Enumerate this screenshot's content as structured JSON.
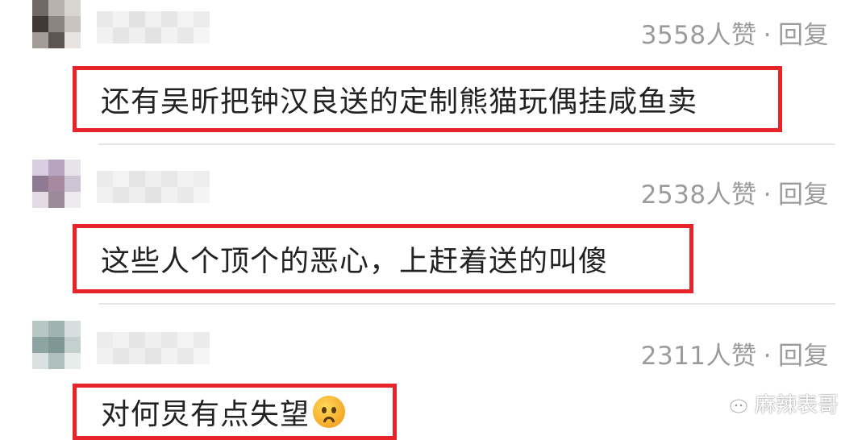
{
  "comments": [
    {
      "likes": "3558人赞",
      "separator": "·",
      "reply": "回复",
      "text": "还有吴昕把钟汉良送的定制熊猫玩偶挂咸鱼卖",
      "has_emoji": false
    },
    {
      "likes": "2538人赞",
      "separator": "·",
      "reply": "回复",
      "text": "这些人个顶个的恶心，上赶着送的叫傻",
      "has_emoji": false
    },
    {
      "likes": "2311人赞",
      "separator": "·",
      "reply": "回复",
      "text": "对何炅有点失望",
      "has_emoji": true,
      "emoji_name": "worried-face-icon"
    }
  ],
  "watermark": {
    "text": "麻辣表哥",
    "icon": "wechat-icon"
  },
  "colors": {
    "highlight_border": "#e8242b",
    "meta_text": "#9b9b9b",
    "body_text": "#222222"
  }
}
